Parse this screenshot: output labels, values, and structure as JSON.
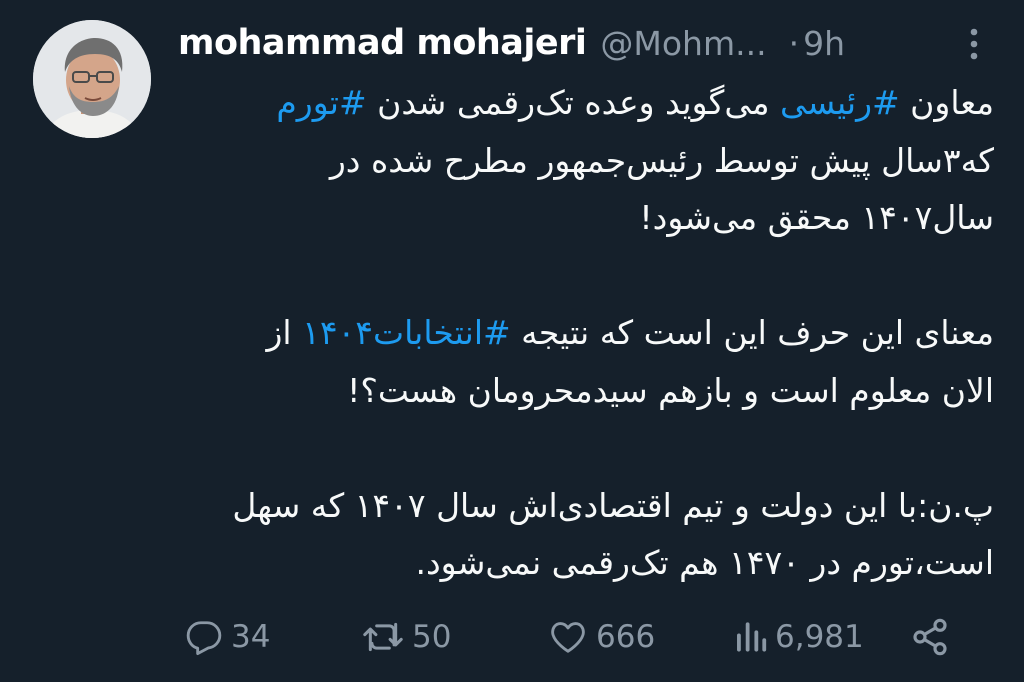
{
  "tweet": {
    "author_name": "mohammad mohajeri",
    "handle": "@Mohm...",
    "separator": "·",
    "time": "9h",
    "body": {
      "l1_a": "معاون ",
      "l1_tag1": "#رئیسی",
      "l1_b": " می‌گوید وعده تک‌رقمی شدن  ",
      "l1_tag2": "#تورم",
      "l2": "که۳سال پیش توسط رئیس‌جمهور مطرح شده در",
      "l3": "سال۱۴۰۷ محقق می‌شود!",
      "l4_a": "معنای این حرف این است که نتیجه ",
      "l4_tag": "#انتخابات۱۴۰۴",
      "l4_b": " از",
      "l5": "الان معلوم است و بازهم سیدمحرومان هست؟!",
      "l6": "پ.ن:با این دولت و تیم اقتصادی‌اش سال ۱۴۰۷ که سهل",
      "l7": "است،تورم در ۱۴۷۰ هم تک‌رقمی نمی‌شود."
    },
    "actions": {
      "replies": "34",
      "retweets": "50",
      "likes": "666",
      "views": "6,981"
    }
  },
  "colors": {
    "background": "#15202b",
    "text": "#f7f9f9",
    "secondary": "#8b98a5",
    "accent": "#1d9bf0"
  },
  "icons": {
    "reply": "reply-icon",
    "retweet": "retweet-icon",
    "like": "heart-icon",
    "views": "views-icon",
    "share": "share-icon",
    "more": "more-vertical-icon"
  }
}
